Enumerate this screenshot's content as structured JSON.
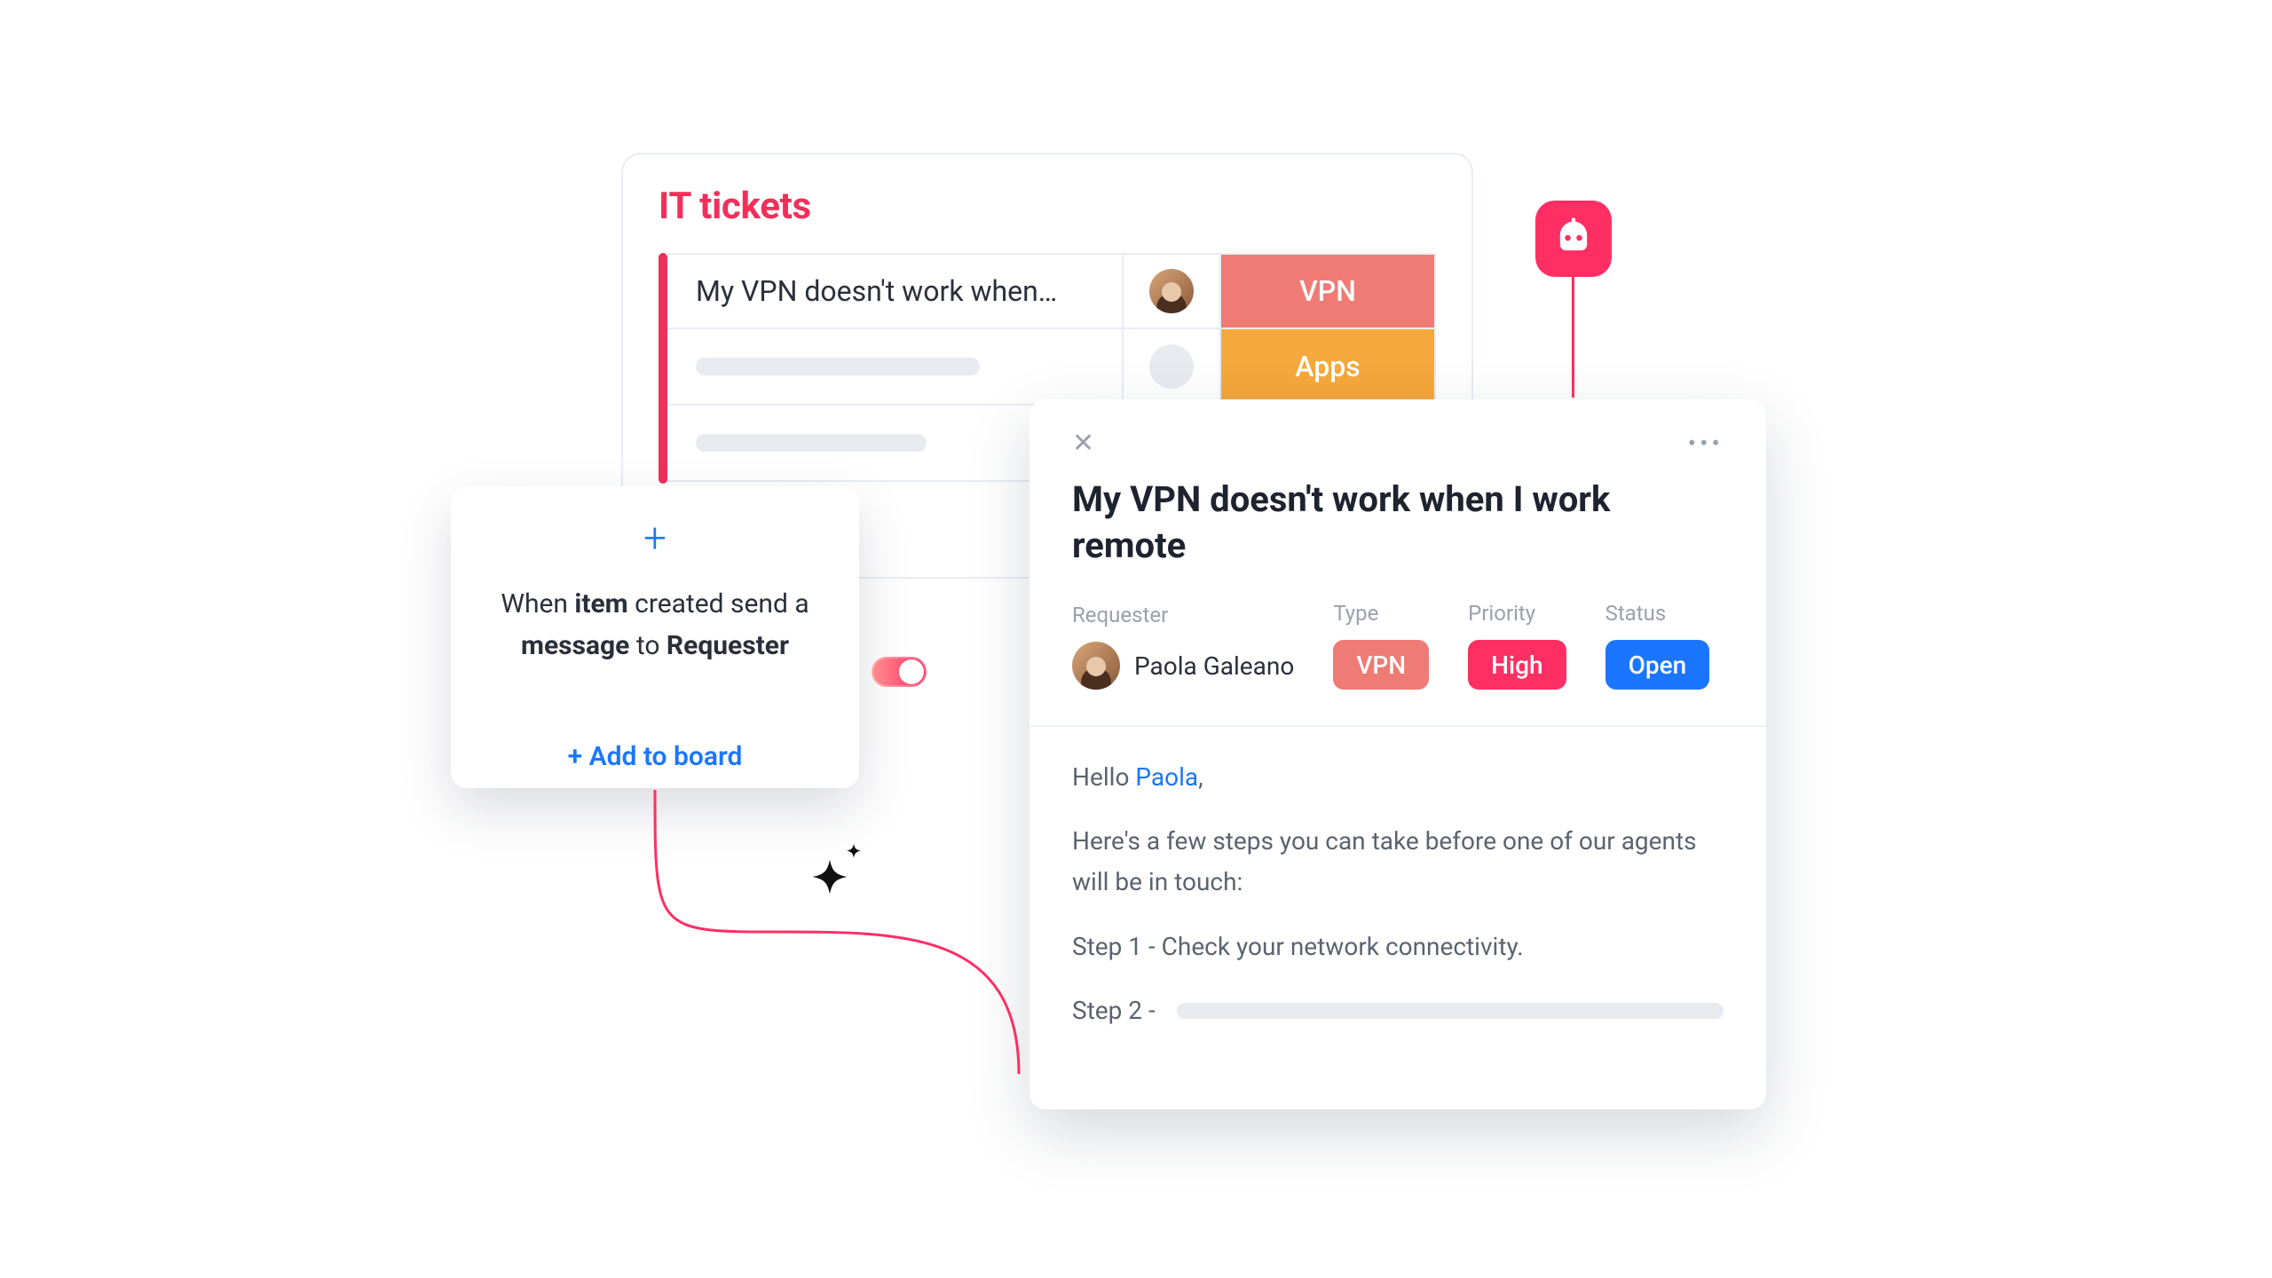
{
  "board": {
    "title": "IT tickets",
    "rows": [
      {
        "title": "My VPN doesn't work when…",
        "tag": "VPN"
      },
      {
        "title": "",
        "tag": "Apps"
      },
      {
        "title": "",
        "tag": ""
      }
    ]
  },
  "recipe": {
    "line_prefix": "When ",
    "b1": "item",
    "mid1": " created send a ",
    "b2": "message",
    "mid2": " to ",
    "b3": "Requester",
    "add_label": "+ Add to board"
  },
  "panel": {
    "title": "My VPN doesn't work when I work remote",
    "labels": {
      "requester": "Requester",
      "type": "Type",
      "priority": "Priority",
      "status": "Status"
    },
    "requester_name": "Paola Galeano",
    "type": "VPN",
    "priority": "High",
    "status": "Open",
    "body": {
      "greeting_pre": "Hello ",
      "greeting_name": "Paola",
      "greeting_post": ",",
      "intro": "Here's a few steps you can take before one of our agents will be in touch:",
      "step1": "Step 1 - Check your network connectivity.",
      "step2_label": "Step 2 -"
    }
  },
  "colors": {
    "accent": "#f0305a",
    "vpn": "#ef7b74",
    "apps": "#f5a83b",
    "high": "#ff2e63",
    "open": "#1b76ff"
  }
}
